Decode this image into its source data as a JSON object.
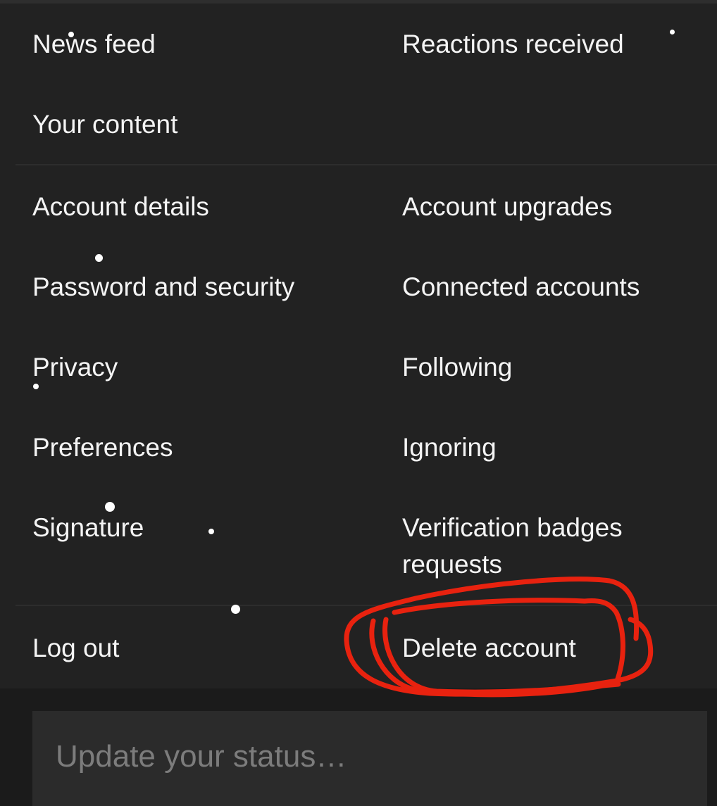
{
  "menu": {
    "group1": {
      "news_feed": "News feed",
      "reactions_received": "Reactions received",
      "your_content": "Your content"
    },
    "group2": {
      "account_details": "Account details",
      "account_upgrades": "Account upgrades",
      "password_and_security": "Password and security",
      "connected_accounts": "Connected accounts",
      "privacy": "Privacy",
      "following": "Following",
      "preferences": "Preferences",
      "ignoring": "Ignoring",
      "signature": "Signature",
      "verification_badges_requests": "Verification badges requests"
    },
    "group3": {
      "log_out": "Log out",
      "delete_account": "Delete account"
    }
  },
  "status": {
    "placeholder": "Update your status…"
  },
  "colors": {
    "background": "#222222",
    "text": "#f4f4f4",
    "annotation": "#e8220f"
  },
  "icons": {
    "annotation": "red-circle-annotation"
  }
}
